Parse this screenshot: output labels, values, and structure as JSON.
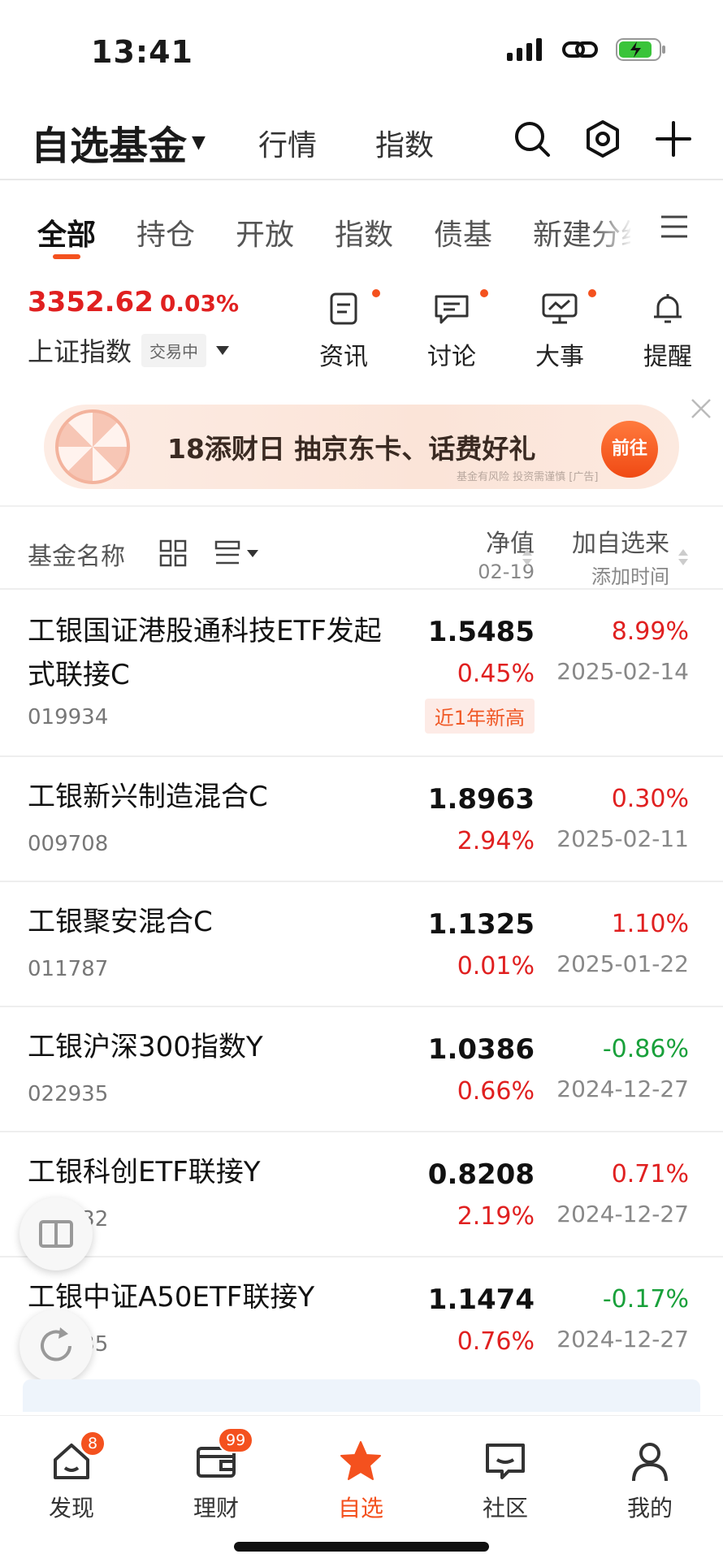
{
  "status_bar": {
    "time": "13:41"
  },
  "header": {
    "title": "自选基金",
    "tabs": [
      "行情",
      "指数"
    ]
  },
  "sub_tabs": [
    "全部",
    "持仓",
    "开放",
    "指数",
    "债基",
    "新建分组"
  ],
  "market_index": {
    "value": "3352.62",
    "change": "0.03%",
    "name": "上证指数",
    "status": "交易中"
  },
  "quick_links": [
    {
      "label": "资讯",
      "icon": "news-icon",
      "has_dot": true
    },
    {
      "label": "讨论",
      "icon": "comment-icon",
      "has_dot": true
    },
    {
      "label": "大事",
      "icon": "chart-screen-icon",
      "has_dot": true
    },
    {
      "label": "提醒",
      "icon": "bell-icon",
      "has_dot": false
    }
  ],
  "banner": {
    "text": "18添财日  抽京东卡、话费好礼",
    "button": "前往",
    "note": "基金有风险 投资需谨慎 [广告]"
  },
  "list_header": {
    "name_col": "基金名称",
    "nav_col": "净值",
    "nav_date": "02-19",
    "since_col": "加自选来",
    "since_sub": "添加时间"
  },
  "funds": [
    {
      "name": "工银国证港股通科技ETF发起式联接C",
      "code": "019934",
      "nav": "1.5485",
      "day_change": "0.45%",
      "gain": "8.99%",
      "gain_dir": "up",
      "added": "2025-02-14",
      "tag": "近1年新高"
    },
    {
      "name": "工银新兴制造混合C",
      "code": "009708",
      "nav": "1.8963",
      "day_change": "2.94%",
      "gain": "0.30%",
      "gain_dir": "up",
      "added": "2025-02-11",
      "tag": ""
    },
    {
      "name": "工银聚安混合C",
      "code": "011787",
      "nav": "1.1325",
      "day_change": "0.01%",
      "gain": "1.10%",
      "gain_dir": "up",
      "added": "2025-01-22",
      "tag": ""
    },
    {
      "name": "工银沪深300指数Y",
      "code": "022935",
      "nav": "1.0386",
      "day_change": "0.66%",
      "gain": "-0.86%",
      "gain_dir": "down",
      "added": "2024-12-27",
      "tag": ""
    },
    {
      "name": "工银科创ETF联接Y",
      "code": "022932",
      "nav": "0.8208",
      "day_change": "2.19%",
      "gain": "0.71%",
      "gain_dir": "up",
      "added": "2024-12-27",
      "tag": ""
    },
    {
      "name": "工银中证A50ETF联接Y",
      "code": "022935",
      "nav": "1.1474",
      "day_change": "0.76%",
      "gain": "-0.17%",
      "gain_dir": "down",
      "added": "2024-12-27",
      "tag": ""
    }
  ],
  "bottom_nav": [
    {
      "label": "发现",
      "icon": "home-icon",
      "badge": "8"
    },
    {
      "label": "理财",
      "icon": "wallet-icon",
      "badge": "99"
    },
    {
      "label": "自选",
      "icon": "star-icon",
      "badge": "",
      "active": true
    },
    {
      "label": "社区",
      "icon": "chat-icon",
      "badge": ""
    },
    {
      "label": "我的",
      "icon": "person-icon",
      "badge": ""
    }
  ],
  "colors": {
    "accent": "#f4511e",
    "up": "#e02020",
    "down": "#18a03a"
  }
}
